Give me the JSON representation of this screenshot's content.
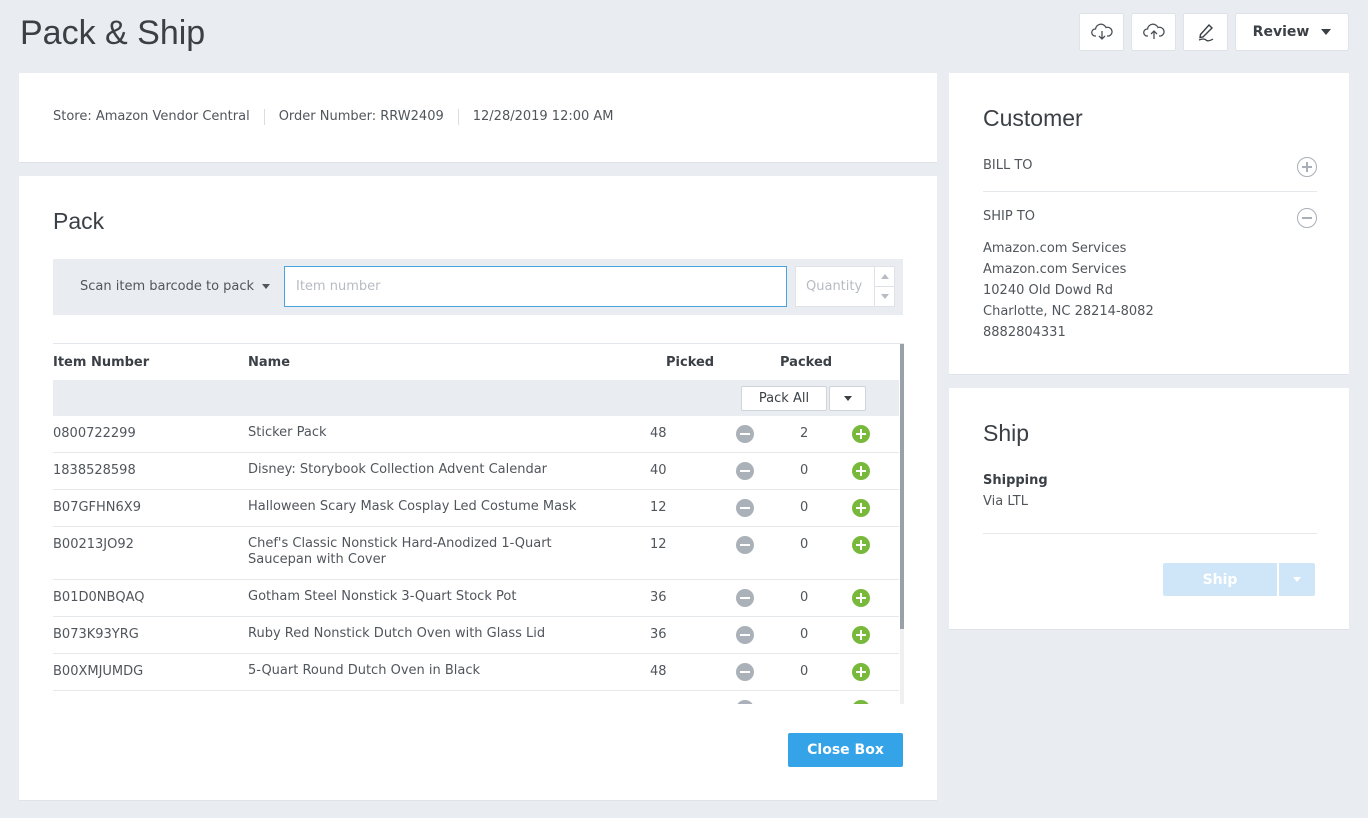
{
  "page": {
    "title": "Pack & Ship"
  },
  "toolbar": {
    "buttons": [
      {
        "icon": "cloud-download-icon"
      },
      {
        "icon": "cloud-upload-icon"
      },
      {
        "icon": "pen-sign-icon"
      }
    ],
    "review_label": "Review"
  },
  "order": {
    "store": "Store: Amazon Vendor Central",
    "number": "Order Number: RRW2409",
    "date": "12/28/2019 12:00 AM"
  },
  "pack": {
    "title": "Pack",
    "scan_mode": "Scan item barcode to pack",
    "item_placeholder": "Item number",
    "qty_placeholder": "Quantity",
    "columns": {
      "item": "Item Number",
      "name": "Name",
      "picked": "Picked",
      "packed": "Packed"
    },
    "pack_all_label": "Pack All",
    "rows": [
      {
        "item": "0800722299",
        "name": "Sticker Pack",
        "picked": "48",
        "packed": "2"
      },
      {
        "item": "1838528598",
        "name": "Disney: Storybook Collection Advent Calendar",
        "picked": "40",
        "packed": "0"
      },
      {
        "item": "B07GFHN6X9",
        "name": "Halloween Scary Mask Cosplay Led Costume Mask",
        "picked": "12",
        "packed": "0"
      },
      {
        "item": "B00213JO92",
        "name": "Chef's Classic Nonstick Hard-Anodized 1-Quart Saucepan with Cover",
        "picked": "12",
        "packed": "0"
      },
      {
        "item": "B01D0NBQAQ",
        "name": "Gotham Steel Nonstick 3-Quart Stock Pot",
        "picked": "36",
        "packed": "0"
      },
      {
        "item": "B073K93YRG",
        "name": "Ruby Red Nonstick Dutch Oven with Glass Lid",
        "picked": "36",
        "packed": "0"
      },
      {
        "item": "B00XMJUMDG",
        "name": "5-Quart Round Dutch Oven in Black",
        "picked": "48",
        "packed": "0"
      }
    ],
    "close_box_label": "Close Box"
  },
  "customer": {
    "title": "Customer",
    "bill_to_label": "BILL TO",
    "ship_to_label": "SHIP TO",
    "ship_to_lines": [
      "Amazon.com Services",
      "Amazon.com Services",
      "10240 Old Dowd Rd",
      "Charlotte, NC 28214-8082",
      "8882804331"
    ]
  },
  "ship": {
    "title": "Ship",
    "shipping_label": "Shipping",
    "shipping_value": "Via LTL",
    "ship_button_label": "Ship"
  },
  "colors": {
    "accent": "#35a3e8",
    "plus_green": "#78b83a",
    "minus_gray": "#aab1b8",
    "background": "#e9edf1"
  }
}
